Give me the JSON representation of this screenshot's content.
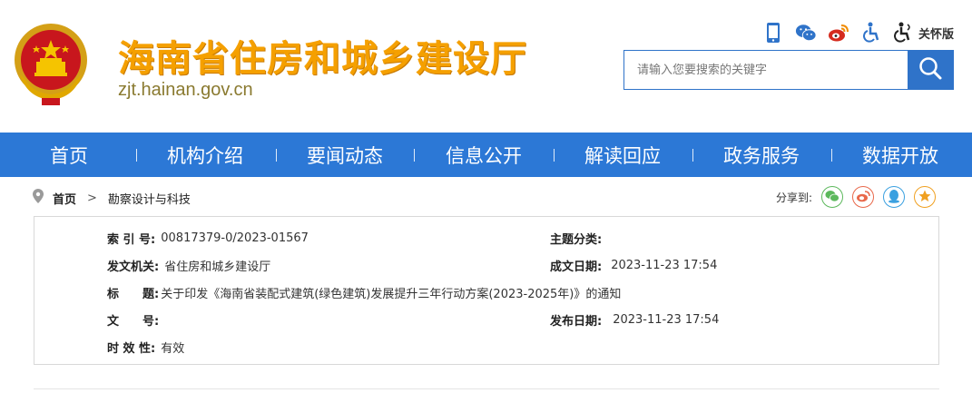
{
  "header": {
    "title": "海南省住房和城乡建设厅",
    "domain": "zjt.hainan.gov.cn",
    "tools": {
      "mobile_icon": "mobile-icon",
      "wechat_icon": "wechat-icon",
      "weibo_icon": "weibo-icon",
      "accessibility_icon": "accessibility-icon",
      "care_label": "关怀版"
    },
    "search": {
      "placeholder": "请输入您要搜索的关键字"
    }
  },
  "nav": {
    "items": [
      {
        "label": "首页"
      },
      {
        "label": "机构介绍"
      },
      {
        "label": "要闻动态"
      },
      {
        "label": "信息公开"
      },
      {
        "label": "解读回应"
      },
      {
        "label": "政务服务"
      },
      {
        "label": "数据开放"
      }
    ]
  },
  "breadcrumb": {
    "home": "首页",
    "separator": ">",
    "current": "勘察设计与科技"
  },
  "share": {
    "label": "分享到:",
    "targets": [
      "wechat",
      "weibo",
      "qq",
      "qzone"
    ]
  },
  "info": {
    "index_label": "索 引 号:",
    "index_value": "00817379-0/2023-01567",
    "subject_label": "主题分类:",
    "subject_value": "",
    "issuer_label": "发文机关:",
    "issuer_value": "省住房和城乡建设厅",
    "created_label": "成文日期:",
    "created_value": "2023-11-23 17:54",
    "title_label": "标　　题:",
    "title_value": "关于印发《海南省装配式建筑(绿色建筑)发展提升三年行动方案(2023-2025年)》的通知",
    "docno_label": "文　　号:",
    "docno_value": "",
    "published_label": "发布日期:",
    "published_value": "2023-11-23 17:54",
    "validity_label": "时 效 性:",
    "validity_value": "有效"
  },
  "colors": {
    "nav_bg": "#2c78d6",
    "title": "#f5a000",
    "search_border": "#2f73c9"
  }
}
